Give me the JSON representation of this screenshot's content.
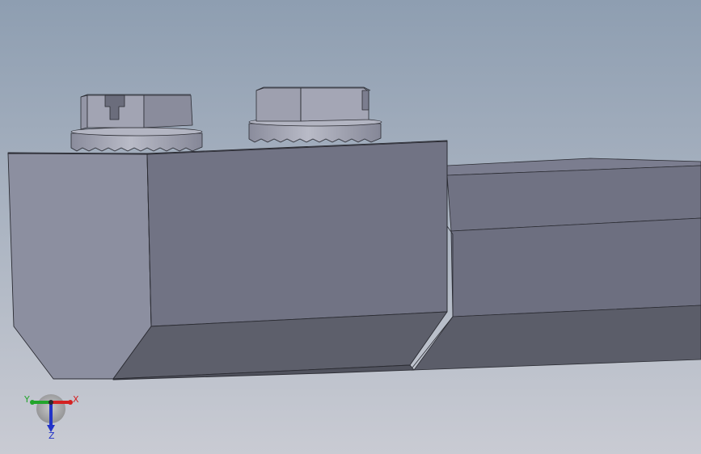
{
  "viewport": {
    "background_top": "#8e9eb1",
    "background_bottom": "#c9cbd3",
    "model_colors": {
      "face_light": "#8d90a0",
      "face_mid": "#737586",
      "face_dark": "#5e606d",
      "face_top": "#82849a",
      "edge": "#2b2c33",
      "bolt_light": "#a5a7b6",
      "bolt_dark": "#7c7e8f"
    },
    "triad": {
      "x_label": "X",
      "y_label": "Y",
      "z_label": "Z",
      "x_color": "#d42222",
      "y_color": "#22a52b",
      "z_color": "#2233c8"
    }
  }
}
